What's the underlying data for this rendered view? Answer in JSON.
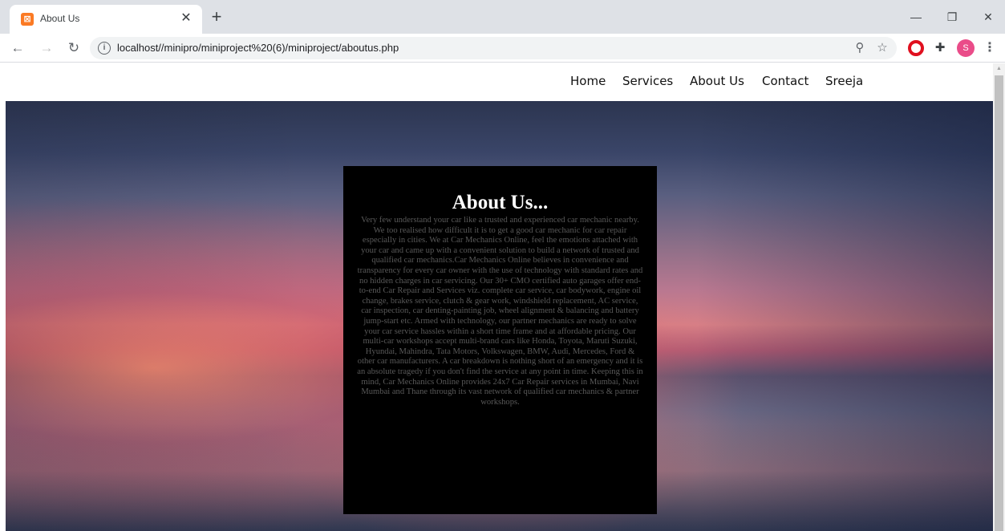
{
  "browser": {
    "tab_title": "About Us",
    "tab_icon": "xampp-favicon",
    "url": "localhost//minipro/miniproject%20(6)/miniproject/aboutus.php",
    "profile_initial": "S"
  },
  "nav": {
    "home": "Home",
    "services": "Services",
    "about": "About Us",
    "contact": "Contact",
    "user": "Sreeja"
  },
  "about": {
    "title": "About Us...",
    "body": "Very few understand your car like a trusted and experienced car mechanic nearby. We too realised how difficult it is to get a good car mechanic for car repair especially in cities. We at Car Mechanics Online, feel the emotions attached with your car and came up with a convenient solution to build a network of trusted and qualified car mechanics.Car Mechanics Online believes in convenience and transparency for every car owner with the use of technology with standard rates and no hidden charges in car servicing. Our 30+ CMO certified auto garages offer end-to-end Car Repair and Services viz. complete car service, car bodywork, engine oil change, brakes service, clutch & gear work, windshield replacement, AC service, car inspection, car denting-painting job, wheel alignment & balancing and battery jump-start etc. Armed with technology, our partner mechanics are ready to solve your car service hassles within a short time frame and at affordable pricing. Our multi-car workshops accept multi-brand cars like Honda, Toyota, Maruti Suzuki, Hyundai, Mahindra, Tata Motors, Volkswagen, BMW, Audi, Mercedes, Ford & other car manufacturers. A car breakdown is nothing short of an emergency and it is an absolute tragedy if you don't find the service at any point in time. Keeping this in mind, Car Mechanics Online provides 24x7 Car Repair services in Mumbai, Navi Mumbai and Thane through its vast network of qualified car mechanics & partner workshops."
  },
  "colors": {
    "box_bg": "#000000",
    "title_color": "#ffffff",
    "body_color": "#595959"
  }
}
